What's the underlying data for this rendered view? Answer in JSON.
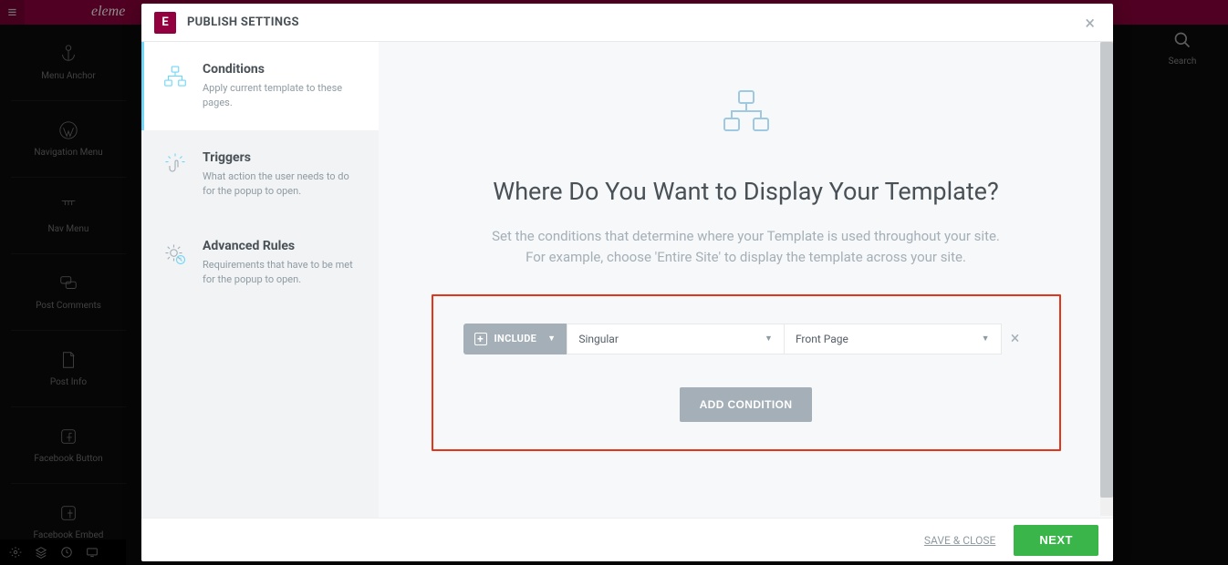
{
  "modal": {
    "badge": "E",
    "title": "PUBLISH SETTINGS"
  },
  "sidebar": {
    "items": [
      {
        "title": "Conditions",
        "desc": "Apply current template to these pages."
      },
      {
        "title": "Triggers",
        "desc": "What action the user needs to do for the popup to open."
      },
      {
        "title": "Advanced Rules",
        "desc": "Requirements that have to be met for the popup to open."
      }
    ]
  },
  "main": {
    "heading": "Where Do You Want to Display Your Template?",
    "sub1": "Set the conditions that determine where your Template is used throughout your site.",
    "sub2": "For example, choose 'Entire Site' to display the template across your site.",
    "condition": {
      "include_label": "INCLUDE",
      "scope": "Singular",
      "target": "Front Page"
    },
    "add_condition": "ADD CONDITION"
  },
  "footer": {
    "save_close": "SAVE & CLOSE",
    "next": "NEXT"
  },
  "bg": {
    "brand": "eleme",
    "widgets": [
      "Menu Anchor",
      "Navigation Menu",
      "Nav Menu",
      "Post Comments",
      "Post Info",
      "Facebook Button",
      "Facebook Embed"
    ],
    "search": "Search"
  }
}
